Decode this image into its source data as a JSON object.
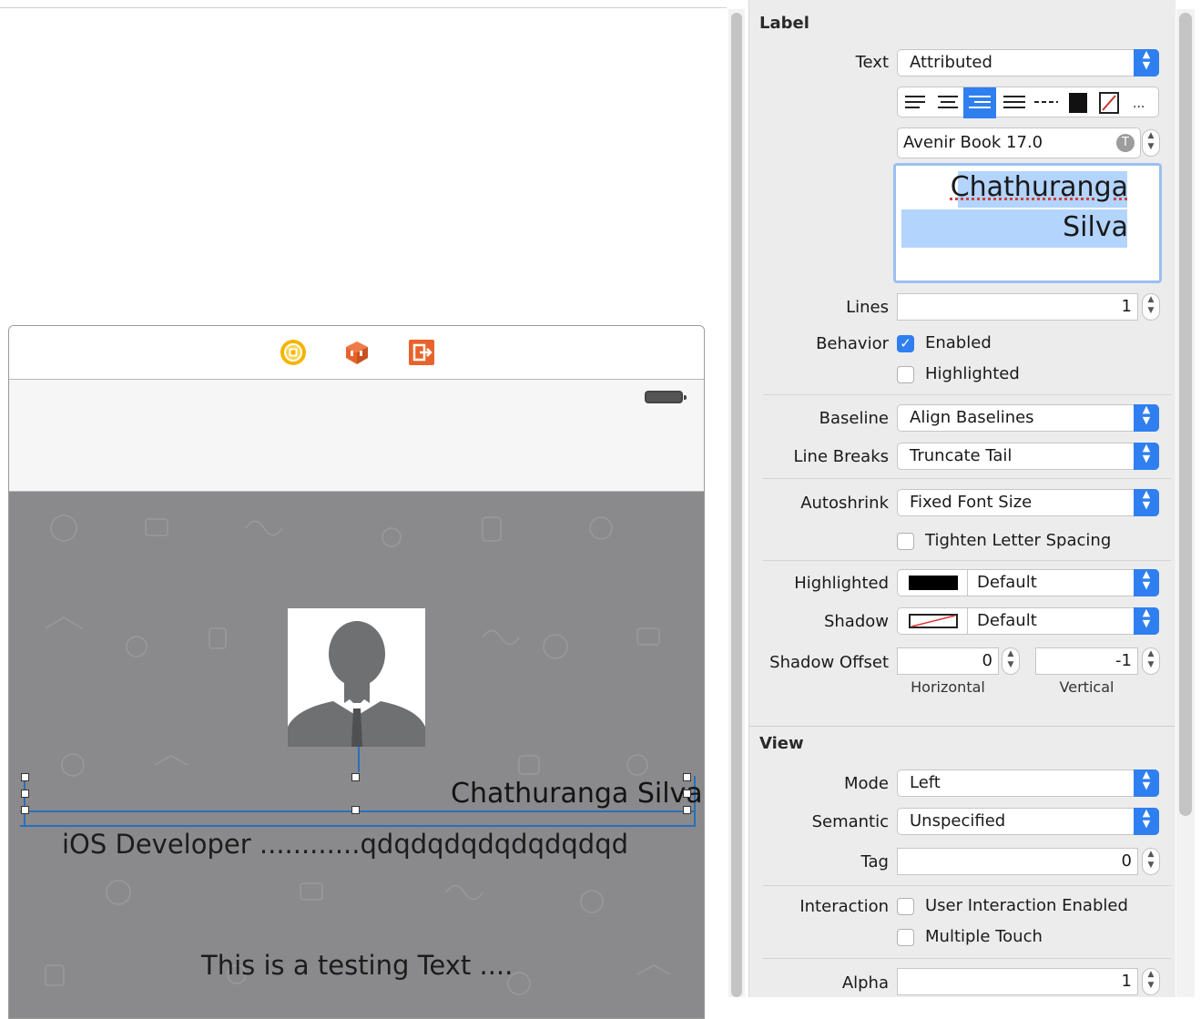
{
  "canvas": {
    "name_label": "Chathuranga Silva",
    "role_label": "iOS Developer ............qdqdqdqdqdqdqdqd",
    "testing_label": "This is a testing Text ...."
  },
  "inspector": {
    "label_section": {
      "title": "Label",
      "text_label": "Text",
      "text_value": "Attributed",
      "font_value": "Avenir Book 17.0",
      "attributed_text_line1": "Chathuranga",
      "attributed_text_line2": "Silva",
      "lines_label": "Lines",
      "lines_value": "1",
      "behavior_label": "Behavior",
      "enabled_label": "Enabled",
      "enabled_checked": true,
      "highlighted_label": "Highlighted",
      "highlighted_checked": false,
      "baseline_label": "Baseline",
      "baseline_value": "Align Baselines",
      "line_breaks_label": "Line Breaks",
      "line_breaks_value": "Truncate Tail",
      "autoshrink_label": "Autoshrink",
      "autoshrink_value": "Fixed Font Size",
      "tighten_label": "Tighten Letter Spacing",
      "tighten_checked": false,
      "highlighted_color_label": "Highlighted",
      "highlighted_color_value": "Default",
      "shadow_label": "Shadow",
      "shadow_value": "Default",
      "shadow_offset_label": "Shadow Offset",
      "shadow_offset_h": "0",
      "shadow_offset_v": "-1",
      "horizontal_label": "Horizontal",
      "vertical_label": "Vertical"
    },
    "view_section": {
      "title": "View",
      "mode_label": "Mode",
      "mode_value": "Left",
      "semantic_label": "Semantic",
      "semantic_value": "Unspecified",
      "tag_label": "Tag",
      "tag_value": "0",
      "interaction_label": "Interaction",
      "user_interaction_label": "User Interaction Enabled",
      "user_interaction_checked": false,
      "multiple_touch_label": "Multiple Touch",
      "multiple_touch_checked": false,
      "alpha_label": "Alpha",
      "alpha_value": "1"
    }
  },
  "colors": {
    "accent": "#2f7ff0",
    "selection": "#b3d4fc",
    "canvas_gray": "#8a8a8c",
    "dock_yellow": "#f5b400",
    "dock_orange": "#e8632b"
  },
  "icons": [
    "view-controller-icon",
    "first-responder-icon",
    "exit-icon",
    "battery-icon",
    "profile-placeholder-icon"
  ]
}
